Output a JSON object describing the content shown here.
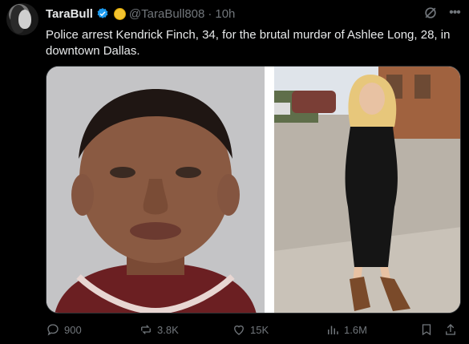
{
  "tweet": {
    "author_name": "TaraBull",
    "handle": "@TaraBull808",
    "separator": "·",
    "time": "10h",
    "text": "Police arrest Kendrick Finch, 34, for the brutal murdər of Ashlee Long, 28, in downtown Dallas."
  },
  "actions": {
    "replies": "900",
    "reposts": "3.8K",
    "likes": "15K",
    "views": "1.6M"
  },
  "icons": [
    "verified-badge-icon",
    "smiley-emoji-icon",
    "grok-icon",
    "more-icon",
    "reply-icon",
    "repost-icon",
    "like-icon",
    "views-icon",
    "bookmark-icon",
    "share-icon"
  ],
  "colors": {
    "background": "#000000",
    "text": "#e7e9ea",
    "secondary": "#71767b",
    "verified": "#1d9bf0"
  }
}
